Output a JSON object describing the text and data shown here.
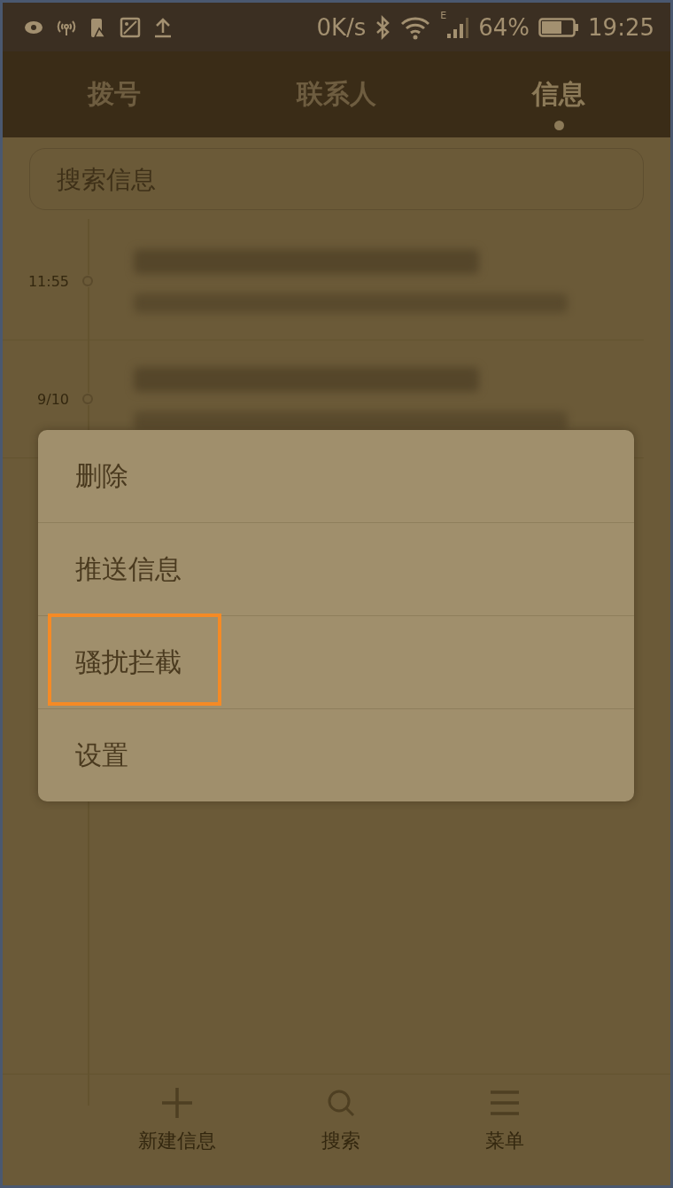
{
  "status_bar": {
    "speed": "0K/s",
    "network": "E",
    "battery": "64%",
    "time": "19:25"
  },
  "tabs": [
    {
      "label": "拨号",
      "selected": false
    },
    {
      "label": "联系人",
      "selected": false
    },
    {
      "label": "信息",
      "selected": true
    }
  ],
  "search": {
    "placeholder": "搜索信息"
  },
  "messages": [
    {
      "time": "11:55"
    },
    {
      "time": "9/10"
    }
  ],
  "menu": [
    {
      "label": "删除",
      "highlighted": false
    },
    {
      "label": "推送信息",
      "highlighted": false
    },
    {
      "label": "骚扰拦截",
      "highlighted": true
    },
    {
      "label": "设置",
      "highlighted": false
    }
  ],
  "bottom_nav": [
    {
      "kind": "add",
      "label": "新建信息"
    },
    {
      "kind": "search",
      "label": "搜索"
    },
    {
      "kind": "menu",
      "label": "菜单"
    }
  ]
}
